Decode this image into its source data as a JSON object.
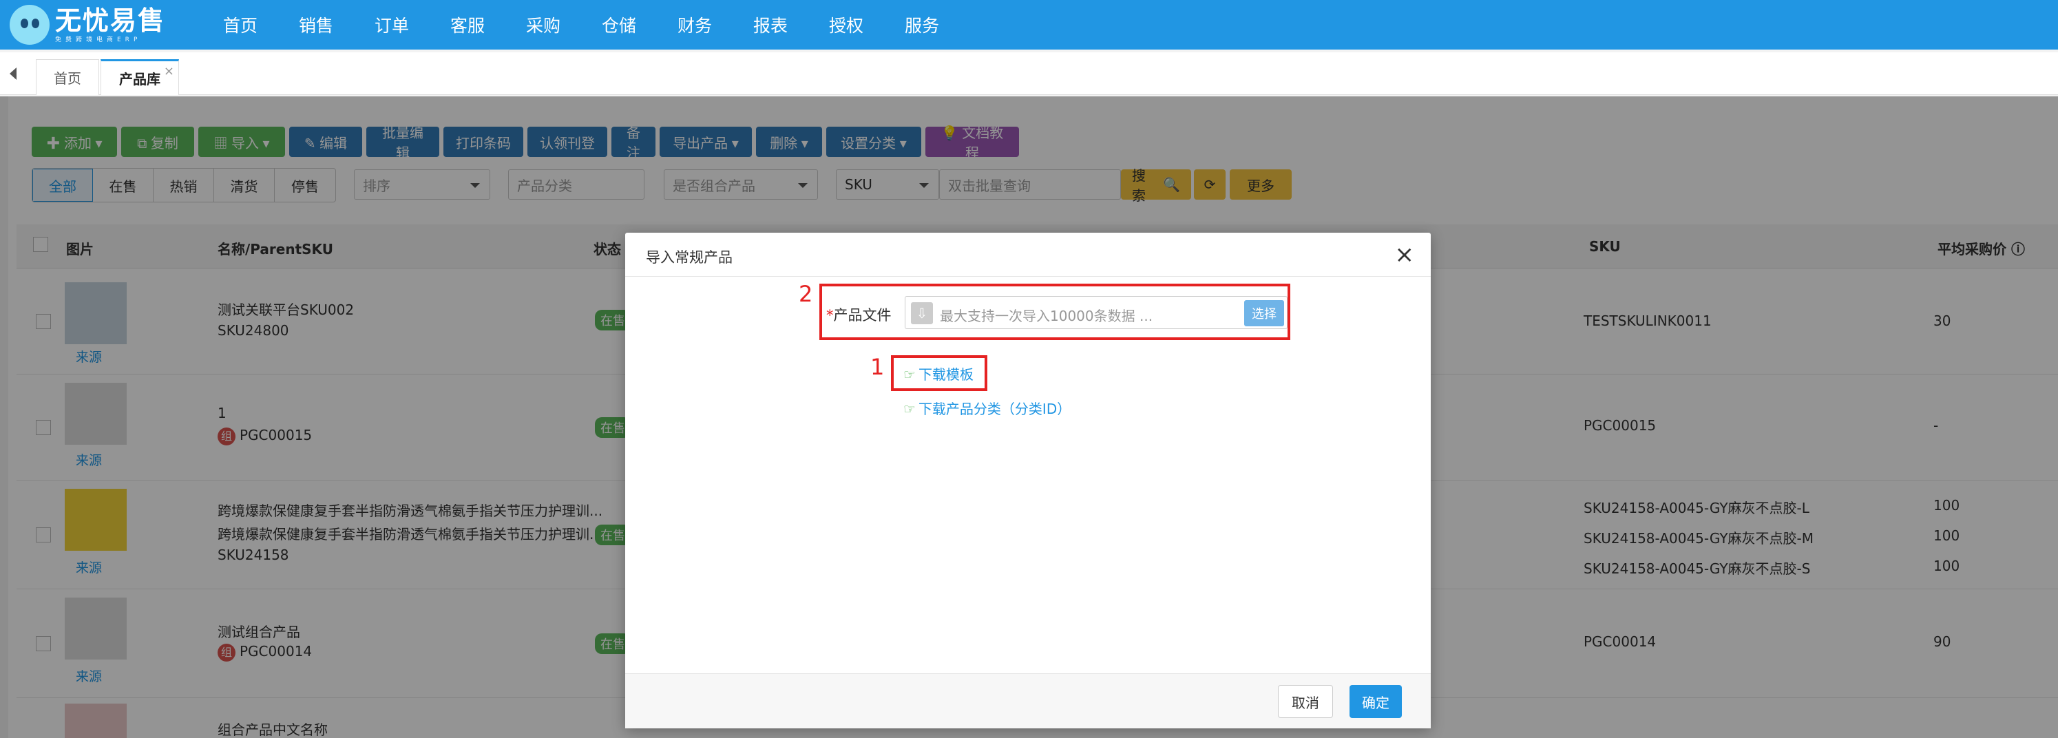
{
  "header": {
    "logo_title": "无忧易售",
    "logo_sub": "免费跨境电商ERP",
    "nav": [
      "首页",
      "销售",
      "订单",
      "客服",
      "采购",
      "仓储",
      "财务",
      "报表",
      "授权",
      "服务"
    ]
  },
  "tabs": {
    "home": "首页",
    "active": "产品库",
    "close": "×"
  },
  "toolbar": {
    "add": "✚ 添加 ▾",
    "copy": "⧉ 复制",
    "import": "▦ 导入 ▾",
    "edit": "✎ 编辑",
    "batch_edit": "批量编辑",
    "print_barcode": "打印条码",
    "claim": "认领刊登",
    "remark": "备注",
    "export": "导出产品 ▾",
    "delete": "删除 ▾",
    "set_category": "设置分类 ▾",
    "docs": "💡 文档教程"
  },
  "filters": {
    "status_tabs": [
      "全部",
      "在售",
      "热销",
      "清货",
      "停售"
    ],
    "sort_placeholder": "排序",
    "category_placeholder": "产品分类",
    "combo_placeholder": "是否组合产品",
    "sku_select": "SKU",
    "batch_query_placeholder": "双击批量查询",
    "search": "搜索",
    "more": "更多"
  },
  "table": {
    "headers": {
      "image": "图片",
      "name": "名称/ParentSKU",
      "status": "状态",
      "sku": "SKU",
      "avg_price": "平均采购价"
    },
    "source_label": "来源",
    "status_label": "在售",
    "combo_badge": "组",
    "rows": [
      {
        "name": "测试关联平台SKU002",
        "parent": "SKU24800",
        "skus": [
          "TESTSKULINK0011"
        ],
        "prices": [
          "30"
        ]
      },
      {
        "name": "1",
        "parent": "PGC00015",
        "skus": [
          "PGC00015"
        ],
        "prices": [
          "-"
        ]
      },
      {
        "name": "跨境爆款保健康复手套半指防滑透气棉氨手指关节压力护理训...",
        "name2": "跨境爆款保健康复手套半指防滑透气棉氨手指关节压力护理训...",
        "parent": "SKU24158",
        "skus": [
          "SKU24158-A0045-GY麻灰不点胶-L",
          "SKU24158-A0045-GY麻灰不点胶-M",
          "SKU24158-A0045-GY麻灰不点胶-S"
        ],
        "prices": [
          "100",
          "100",
          "100"
        ]
      },
      {
        "name": "测试组合产品",
        "parent": "PGC00014",
        "skus": [
          "PGC00014"
        ],
        "prices": [
          "90"
        ]
      },
      {
        "name": "组合产品中文名称",
        "parent": "",
        "skus": [],
        "prices": []
      }
    ]
  },
  "modal": {
    "title": "导入常规产品",
    "close": "×",
    "required_mark": "*",
    "file_label": "产品文件",
    "file_placeholder": "最大支持一次导入10000条数据 ...",
    "select_button": "选择",
    "download_template": "下载模板",
    "download_category": "下载产品分类（分类ID）",
    "marker_1": "1",
    "marker_2": "2",
    "cancel": "取消",
    "confirm": "确定"
  }
}
